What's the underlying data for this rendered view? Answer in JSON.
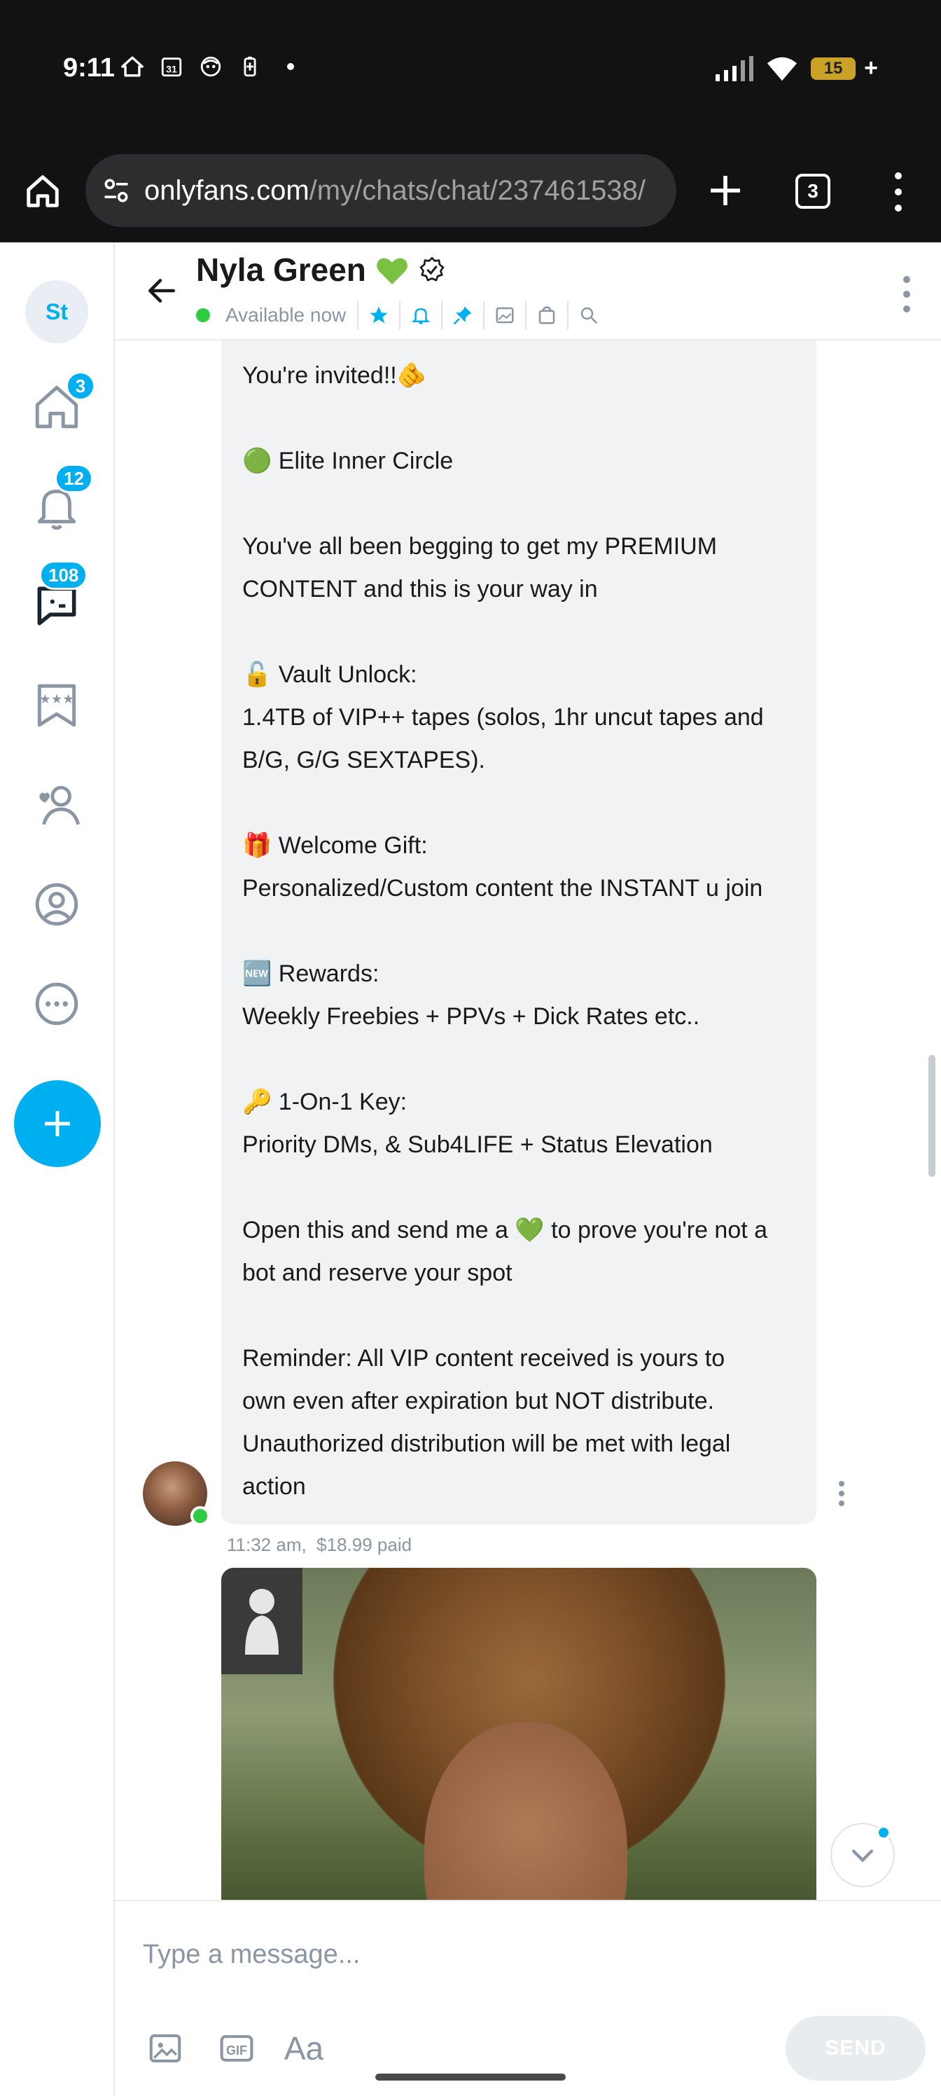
{
  "status_bar": {
    "time": "9:11",
    "calendar_date": "31",
    "battery_level": "15",
    "icons_left": [
      "home-alert-icon",
      "calendar-icon",
      "face-icon",
      "battery-saver-icon"
    ],
    "icons_right": [
      "signal-icon",
      "wifi-icon",
      "battery-icon"
    ]
  },
  "browser": {
    "url_host": "onlyfans.com",
    "url_path": "/my/chats/chat/237461538/",
    "tab_count": "3"
  },
  "sidebar": {
    "avatar_initials": "St",
    "items": [
      {
        "name": "home",
        "badge": "3"
      },
      {
        "name": "notifications",
        "badge": "12"
      },
      {
        "name": "messages",
        "badge": "108"
      },
      {
        "name": "collections",
        "badge": ""
      },
      {
        "name": "subscriptions",
        "badge": ""
      },
      {
        "name": "profile",
        "badge": ""
      },
      {
        "name": "more",
        "badge": ""
      }
    ]
  },
  "chat_header": {
    "name": "Nyla Green",
    "status": "Available now"
  },
  "message": {
    "lines": [
      "You're invited!!🫵",
      "",
      "🟢 Elite Inner Circle",
      "",
      "You've all been begging to get my PREMIUM",
      "CONTENT and this is your way in",
      "",
      "🔓 Vault Unlock:",
      "1.4TB of VIP++ tapes (solos, 1hr uncut tapes and",
      "B/G, G/G SEXTAPES).",
      "",
      "🎁 Welcome Gift:",
      "Personalized/Custom content the INSTANT u join",
      "",
      "🆕 Rewards:",
      "Weekly Freebies + PPVs + Dick Rates etc..",
      "",
      "🔑 1-On-1 Key:",
      "Priority DMs, & Sub4LIFE + Status Elevation",
      "",
      "Open this and send me a 💚 to prove you're not a",
      "bot and reserve your spot",
      "",
      "Reminder: All VIP content received is yours to",
      "own even after expiration but NOT distribute.",
      "Unauthorized distribution will be met with legal",
      "action"
    ],
    "time": "11:32 am,",
    "price": "$18.99 paid"
  },
  "composer": {
    "placeholder": "Type a message...",
    "format_label": "Aa",
    "send_label": "SEND"
  },
  "colors": {
    "accent": "#00aff0",
    "online": "#2ecc40",
    "bubble": "#f0f2f4",
    "muted": "#8a96a3"
  }
}
